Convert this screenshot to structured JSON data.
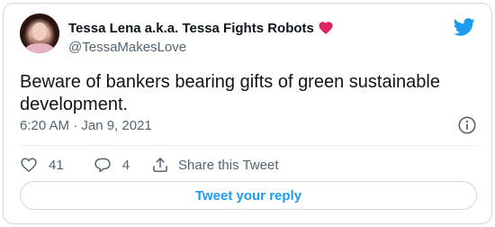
{
  "author": {
    "display_name": "Tessa Lena a.k.a. Tessa Fights Robots",
    "handle": "@TessaMakesLove"
  },
  "tweet": {
    "text": "Beware of bankers bearing gifts of green sustainable development.",
    "timestamp": "6:20 AM · Jan 9, 2021"
  },
  "actions": {
    "like_count": "41",
    "reply_count": "4",
    "share_label": "Share this Tweet"
  },
  "reply_button": {
    "label": "Tweet your reply"
  },
  "icons": {
    "heart": "red-heart-emoji",
    "brand": "twitter-bird-icon",
    "info": "info-icon",
    "like": "heart-outline-icon",
    "reply": "speech-bubble-icon",
    "share": "share-upload-icon"
  },
  "colors": {
    "accent": "#1d9bf0",
    "heart": "#e0245e",
    "secondary_text": "#536471",
    "border": "#cfd9de"
  }
}
